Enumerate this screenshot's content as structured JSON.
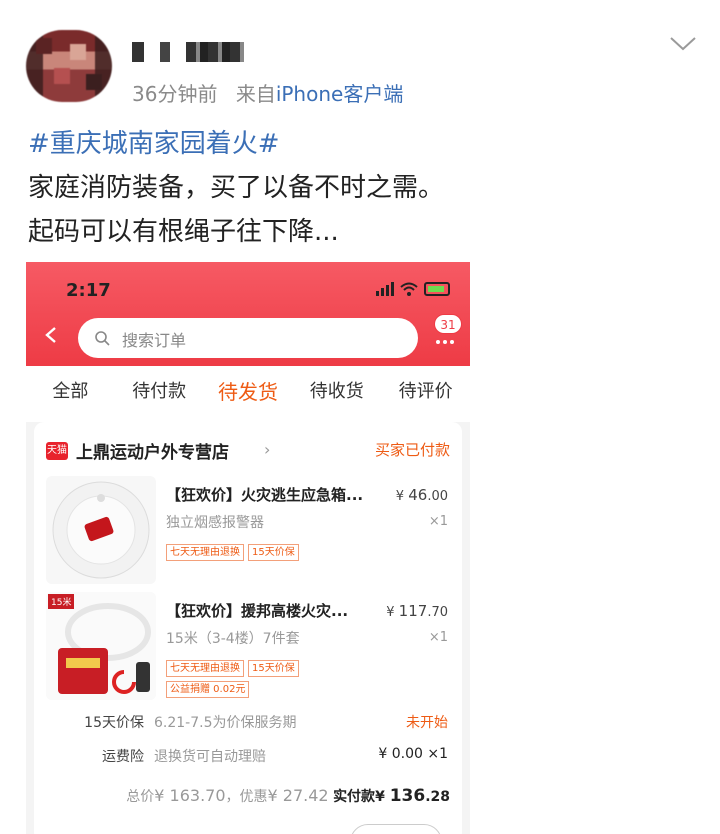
{
  "post": {
    "meta_time": "36分钟前",
    "meta_from": "来自",
    "meta_client": "iPhone客户端",
    "topic": "#重庆城南家园着火#",
    "line1": "家庭消防装备，买了以备不时之需。",
    "line2": "起码可以有根绳子往下降..."
  },
  "phone": {
    "status_time": "2:17",
    "search_placeholder": "搜索订单",
    "message_badge": "31",
    "tabs": [
      "全部",
      "待付款",
      "待发货",
      "待收货",
      "待评价"
    ],
    "active_tab": "待发货",
    "order": {
      "store_logo": "天猫",
      "store_name": "上鼎运动户外专营店",
      "status": "买家已付款",
      "items": [
        {
          "title_prefix": "【狂欢价】",
          "title": "火灾逃生应急箱...",
          "price_symbol": "¥",
          "price_int": "46",
          "price_dec": ".00",
          "spec": "独立烟感报警器",
          "qty": "×1",
          "tags": [
            "七天无理由退换",
            "15天价保"
          ]
        },
        {
          "title_prefix": "【狂欢价】",
          "title": "援邦高楼火灾...",
          "price_symbol": "¥",
          "price_int": "117",
          "price_dec": ".70",
          "spec": "15米（3-4楼）7件套",
          "qty": "×1",
          "tags": [
            "七天无理由退换",
            "15天价保",
            "公益捐赠 0.02元"
          ],
          "img_label": "15米"
        }
      ],
      "price_protect_label": "15天价保",
      "price_protect_desc": "6.21-7.5为价保服务期",
      "price_protect_status": "未开始",
      "shipping_ins_label": "运费险",
      "shipping_ins_desc": "退换货可自动理赔",
      "shipping_ins_price": "¥ 0.00 ×1",
      "total_label": "总价",
      "total_value": "¥ 163.70",
      "discount_label": "优惠",
      "discount_value": "¥ 27.42",
      "paid_label": "实付款",
      "paid_symbol": "¥",
      "paid_int": "136",
      "paid_dec": ".28"
    }
  },
  "colors": {
    "topic_blue": "#3b6fb6",
    "header_red": "#ee3b45",
    "accent_orange": "#ee5b14"
  }
}
